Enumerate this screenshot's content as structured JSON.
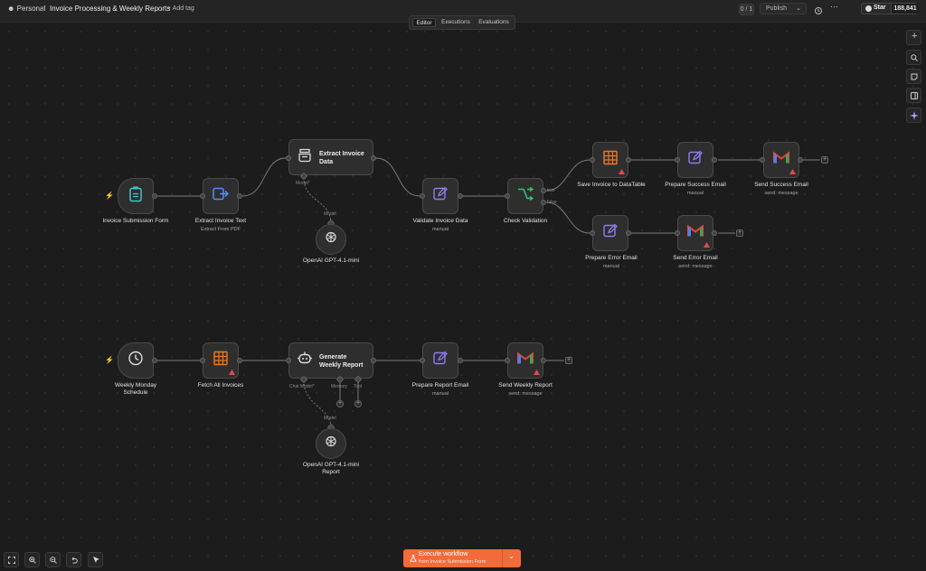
{
  "header": {
    "workspace": "Personal",
    "workflow_title": "Invoice Processing & Weekly Reports",
    "add_tag": "+ Add tag",
    "counter": "0 / 1",
    "publish": "Publish",
    "star": "Star",
    "star_count": "188,841"
  },
  "tabs": [
    "Editor",
    "Executions",
    "Evaluations"
  ],
  "active_tab": "Editor",
  "nodes": {
    "invoice_form": {
      "label": "Invoice Submission Form"
    },
    "extract_text": {
      "label": "Extract Invoice Text",
      "sub": "Extract From PDF"
    },
    "extract_data": {
      "title": "Extract Invoice Data",
      "port_label": "Model*"
    },
    "openai_1": {
      "label": "OpenAI GPT-4.1-mini",
      "port_label": "Model"
    },
    "validate": {
      "label": "Validate Invoice Data",
      "sub": "manual"
    },
    "check": {
      "label": "Check Validation",
      "true_label": "true",
      "false_label": "false"
    },
    "save_invoice": {
      "label": "Save Invoice to DataTable"
    },
    "prep_success": {
      "label": "Prepare Success Email",
      "sub": "manual"
    },
    "send_success": {
      "label": "Send Success Email",
      "sub": "send: message"
    },
    "prep_error": {
      "label": "Prepare Error Email",
      "sub": "manual"
    },
    "send_error": {
      "label": "Send Error Email",
      "sub": "send: message"
    },
    "schedule": {
      "label": "Weekly Monday Schedule"
    },
    "fetch": {
      "label": "Fetch All Invoices"
    },
    "generate": {
      "title": "Generate Weekly Report",
      "chat_model": "Chat Model*",
      "memory": "Memory",
      "tool": "Tool"
    },
    "openai_2": {
      "label": "OpenAI GPT-4.1-mini Report",
      "port_label": "Model"
    },
    "prep_report": {
      "label": "Prepare Report Email",
      "sub": "manual"
    },
    "send_report": {
      "label": "Send Weekly Report",
      "sub": "send: message"
    }
  },
  "execute": {
    "title": "Execute workflow",
    "sub": "from Invoice Submission Form"
  },
  "colors": {
    "accent": "#f26b3a",
    "edit": "#8f7cf0",
    "datatable": "#f0781f",
    "check": "#35c46d",
    "form": "#3fc7c7",
    "extract": "#5b8cf5"
  }
}
